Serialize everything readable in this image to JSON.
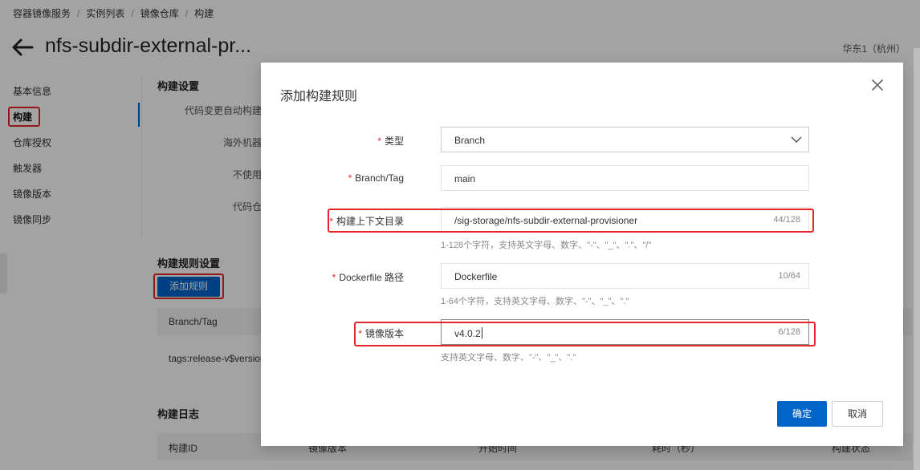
{
  "breadcrumb": [
    "容器镜像服务",
    "实例列表",
    "镜像仓库",
    "构建"
  ],
  "page": {
    "title": "nfs-subdir-external-pr...",
    "region": "华东1（杭州）"
  },
  "side_nav": [
    "基本信息",
    "构建",
    "仓库授权",
    "触发器",
    "镜像版本",
    "镜像同步"
  ],
  "build_settings": {
    "title": "构建设置",
    "labels": [
      "代码变更自动构建",
      "海外机器",
      "不使用",
      "代码仓"
    ]
  },
  "build_rules": {
    "title": "构建规则设置",
    "add_button": "添加规则",
    "table_header": "Branch/Tag",
    "row_value": "tags:release-v$version"
  },
  "build_log": {
    "title": "构建日志",
    "columns": [
      "构建ID",
      "镜像版本",
      "开始时间",
      "耗时（秒）",
      "构建状态"
    ]
  },
  "dialog": {
    "title": "添加构建规则",
    "required_mark": "*",
    "fields": {
      "type": {
        "label": "类型",
        "value": "Branch"
      },
      "branch_tag": {
        "label": "Branch/Tag",
        "value": "main"
      },
      "context_dir": {
        "label": "构建上下文目录",
        "value": "/sig-storage/nfs-subdir-external-provisioner",
        "count": "44/128",
        "hint": "1-128个字符，支持英文字母、数字、\"-\"、\"_\"、\".\"、\"/\""
      },
      "dockerfile": {
        "label": "Dockerfile 路径",
        "value": "Dockerfile",
        "count": "10/64",
        "hint": "1-64个字符，支持英文字母、数字、\"-\"、\"_\"、\".\""
      },
      "image_version": {
        "label": "镜像版本",
        "value": "v4.0.2",
        "count": "6/128",
        "hint": "支持英文字母、数字、\"-\"、\"_\"、\".\""
      }
    },
    "confirm": "确定",
    "cancel": "取消"
  },
  "colors": {
    "primary": "#0064c8",
    "highlight": "#e5252a"
  },
  "icons": [
    "back-arrow-icon",
    "close-icon",
    "chevron-down-icon"
  ]
}
